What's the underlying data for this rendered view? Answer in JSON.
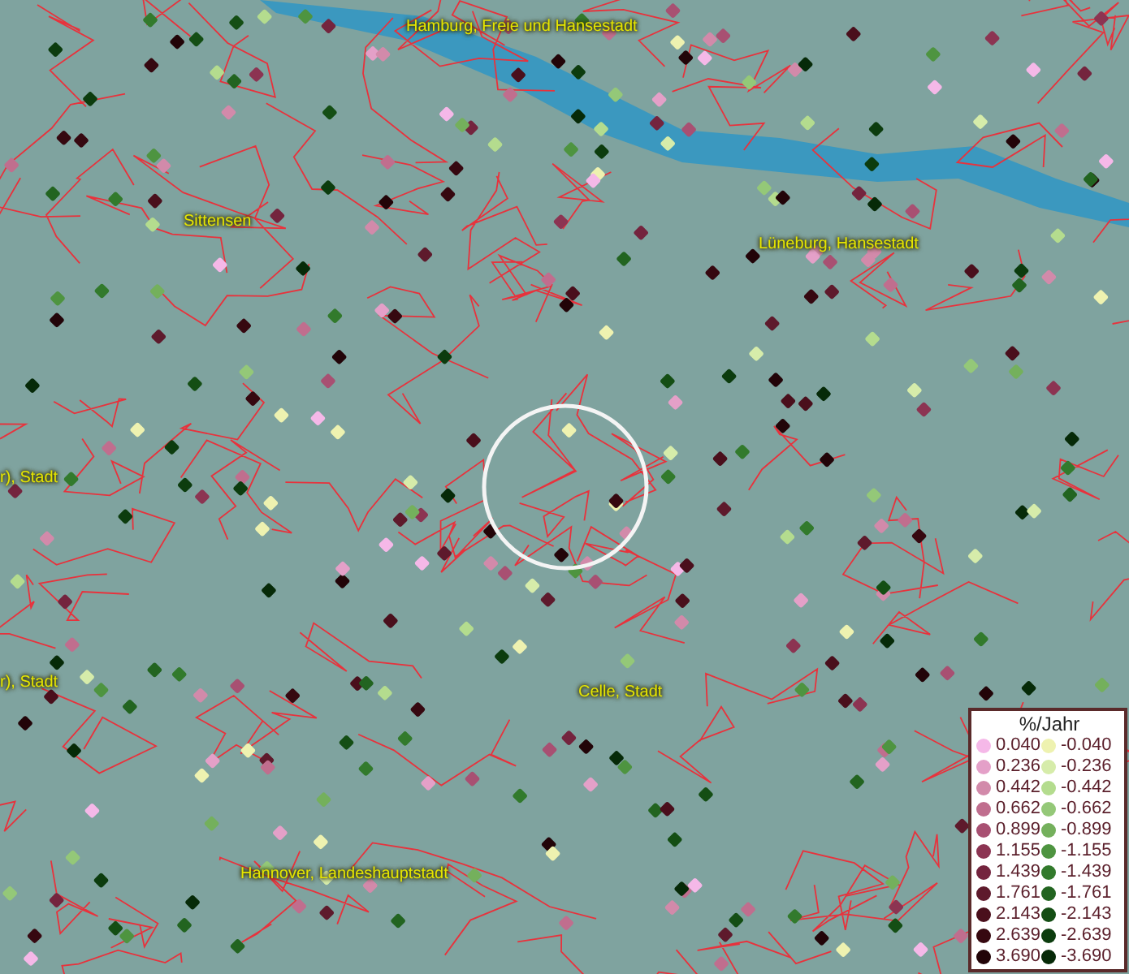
{
  "map_labels": [
    {
      "text": "Hamburg, Freie und Hansestadt"
    },
    {
      "text": "Sittensen"
    },
    {
      "text": "Lüneburg, Hansestadt"
    },
    {
      "text": "r), Stadt"
    },
    {
      "text": "r), Stadt"
    },
    {
      "text": "Celle, Stadt"
    },
    {
      "text": "Hannover, Landeshauptstadt"
    }
  ],
  "legend": {
    "title": "%/Jahr",
    "positive": [
      {
        "label": "0.040",
        "color": "#f5b8e8"
      },
      {
        "label": "0.236",
        "color": "#e4a0c8"
      },
      {
        "label": "0.442",
        "color": "#d28aaa"
      },
      {
        "label": "0.662",
        "color": "#c06e8e"
      },
      {
        "label": "0.899",
        "color": "#a85072"
      },
      {
        "label": "1.155",
        "color": "#8c3452"
      },
      {
        "label": "1.439",
        "color": "#74243e"
      },
      {
        "label": "1.761",
        "color": "#5e1a2c"
      },
      {
        "label": "2.143",
        "color": "#4a0f1c"
      },
      {
        "label": "2.639",
        "color": "#360810"
      },
      {
        "label": "3.690",
        "color": "#220408"
      }
    ],
    "negative": [
      {
        "label": "-0.040",
        "color": "#eef2b0"
      },
      {
        "label": "-0.236",
        "color": "#d6ecaa"
      },
      {
        "label": "-0.442",
        "color": "#b4dc8e"
      },
      {
        "label": "-0.662",
        "color": "#94c878"
      },
      {
        "label": "-0.899",
        "color": "#74b05c"
      },
      {
        "label": "-1.155",
        "color": "#4e9440"
      },
      {
        "label": "-1.439",
        "color": "#327a2c"
      },
      {
        "label": "-1.761",
        "color": "#226420"
      },
      {
        "label": "-2.143",
        "color": "#144e14"
      },
      {
        "label": "-2.639",
        "color": "#0c3c0e"
      },
      {
        "label": "-3.690",
        "color": "#062a08"
      }
    ]
  }
}
